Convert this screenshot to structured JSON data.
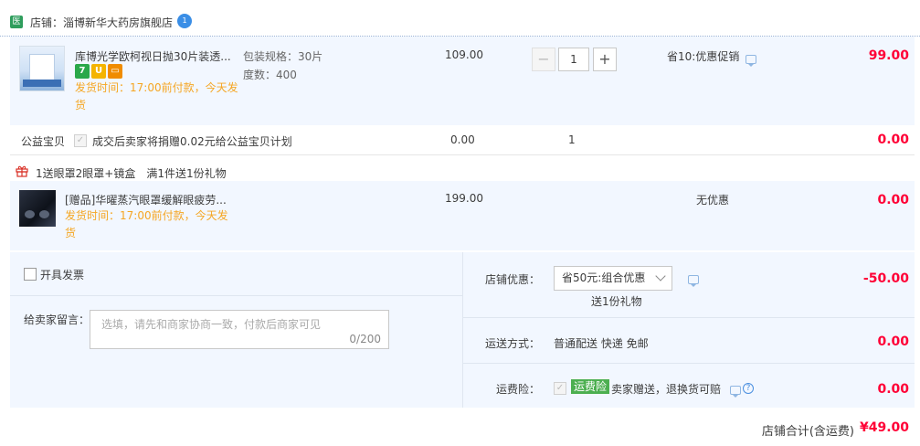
{
  "shop": {
    "icon": "医",
    "label": "店铺：淄博新华大药房旗舰店",
    "badge": "1"
  },
  "item1": {
    "title": "库博光学欧柯视日抛30片装透...",
    "spec_label": "包装规格：30片",
    "degree_label": "度数：400",
    "delivery_line1": "发货时间：17:00前付款，今天发",
    "delivery_line2": "货",
    "unit_price": "109.00",
    "quantity": "1",
    "promo": "省10:优惠促销",
    "amount": "99.00",
    "tag_icons": [
      "seven-day-icon",
      "guarantee-icon",
      "card-icon"
    ]
  },
  "charity": {
    "label": "公益宝贝",
    "desc": "成交后卖家将捐赠0.02元给公益宝贝计划",
    "price": "0.00",
    "quantity": "1",
    "amount": "0.00"
  },
  "gift_header": {
    "text": "1送眼罩2眼罩+镜盒　满1件送1份礼物"
  },
  "item2": {
    "title": "[赠品]华曜蒸汽眼罩缓解眼疲劳...",
    "delivery_line1": "发货时间：17:00前付款，今天发",
    "delivery_line2": "货",
    "unit_price": "199.00",
    "promo": "无优惠",
    "amount": "0.00"
  },
  "invoice": {
    "label": "开具发票"
  },
  "message": {
    "label": "给卖家留言：",
    "placeholder": "选填，请先和商家协商一致，付款后商家可见",
    "counter": "0/200"
  },
  "discount": {
    "label": "店铺优惠：",
    "selected": "省50元:组合优惠",
    "sub": "送1份礼物",
    "amount": "-50.00"
  },
  "shipping": {
    "label": "运送方式：",
    "value": "普通配送 快递 免邮",
    "amount": "0.00"
  },
  "insurance": {
    "label": "运费险：",
    "badge": "运费险",
    "desc": "卖家赠送，退换货可赔",
    "amount": "0.00"
  },
  "total": {
    "label": "店铺合计(含运费)",
    "amount": "¥49.00"
  },
  "colors": {
    "accent_red": "#ff0036",
    "orange": "#f5a623",
    "band": "#f2f7ff",
    "green": "#4caf50"
  }
}
